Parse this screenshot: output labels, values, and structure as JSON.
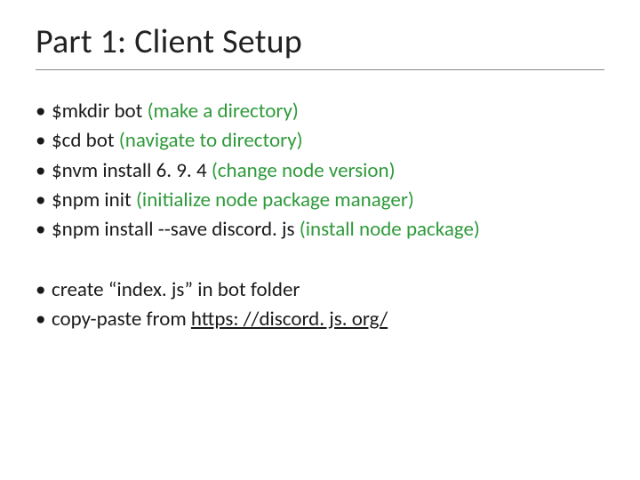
{
  "title": "Part 1: Client Setup",
  "g1": {
    "i0": {
      "cmd": "$mkdir bot ",
      "note": "(make a directory)"
    },
    "i1": {
      "cmd": "$cd bot ",
      "note": "(navigate to directory)"
    },
    "i2": {
      "cmd": "$nvm install 6. 9. 4 ",
      "note": "(change node version)"
    },
    "i3": {
      "cmd": "$npm init ",
      "note": "(initialize node package manager)"
    },
    "i4": {
      "cmd": "$npm install --save discord. js ",
      "note": "(install node package)"
    }
  },
  "g2": {
    "i0": {
      "text": "create “index. js” in bot folder"
    },
    "i1": {
      "pre": "copy-paste from ",
      "link": "https: //discord. js. org/"
    }
  }
}
